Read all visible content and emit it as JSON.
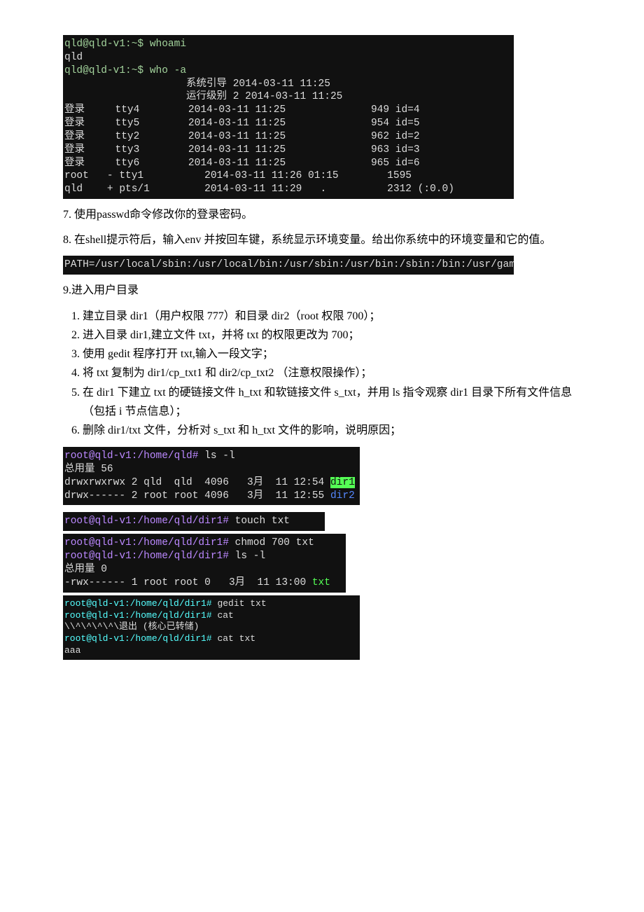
{
  "term1": {
    "l1": "qld@qld-v1:~$ whoami",
    "l2": "qld",
    "l3": "qld@qld-v1:~$ who -a",
    "l4": "                    系统引导 2014-03-11 11:25",
    "l5": "                    运行级别 2 2014-03-11 11:25",
    "l6": "登录     tty4        2014-03-11 11:25              949 id=4",
    "l7": "登录     tty5        2014-03-11 11:25              954 id=5",
    "l8": "登录     tty2        2014-03-11 11:25              962 id=2",
    "l9": "登录     tty3        2014-03-11 11:25              963 id=3",
    "l10": "登录     tty6        2014-03-11 11:25              965 id=6",
    "l11": "root   - tty1          2014-03-11 11:26 01:15        1595",
    "l12": "qld    + pts/1         2014-03-11 11:29   .          2312 (:0.0)"
  },
  "p7": "7. 使用passwd命令修改你的登录密码。",
  "p8": "8. 在shell提示符后，输入env 并按回车键，系统显示环境变量。给出你系统中的环境变量和它的值。",
  "term2": "PATH=/usr/local/sbin:/usr/local/bin:/usr/sbin:/usr/bin:/sbin:/bin:/usr/games",
  "h9": "9.进入用户目录",
  "steps": [
    "建立目录 dir1（用户权限 777）和目录 dir2（root 权限 700）；",
    "进入目录 dir1,建立文件 txt，并将 txt 的权限更改为 700；",
    "使用 gedit 程序打开 txt,输入一段文字；",
    "将 txt 复制为 dir1/cp_txt1 和 dir2/cp_txt2 （注意权限操作）；",
    "在 dir1 下建立 txt 的硬链接文件 h_txt 和软链接文件 s_txt，并用 ls 指令观察 dir1 目录下所有文件信息（包括 i 节点信息）；",
    "删除 dir1/txt 文件，分析对 s_txt 和 h_txt 文件的影响，说明原因；"
  ],
  "term3": {
    "l1p": "root@qld-v1:/home/qld#",
    "l1c": " ls -l",
    "l2": "总用量 56",
    "l3a": "drwxrwxrwx 2 qld  qld  4096   3月  11 12:54 ",
    "l3b": "dir1",
    "l4a": "drwx------ 2 root root 4096   3月  11 12:55 ",
    "l4b": "dir2"
  },
  "term4": {
    "l1p": "root@qld-v1:/home/qld/dir1#",
    "l1c": " touch txt "
  },
  "term5": {
    "l1p": "root@qld-v1:/home/qld/dir1#",
    "l1c": " chmod 700 txt",
    "l2p": "root@qld-v1:/home/qld/dir1#",
    "l2c": " ls -l",
    "l3": "总用量 0",
    "l4a": "-rwx------ 1 root root 0   3月  11 13:00 ",
    "l4b": "txt"
  },
  "term6": {
    "l1p": "root@qld-v1:/home/qld/dir1#",
    "l1c": " gedit txt",
    "l2p": "root@qld-v1:/home/qld/dir1#",
    "l2c": " cat",
    "l3": "\\\\^\\^\\^\\^\\退出 (核心已转储)",
    "l4p": "root@qld-v1:/home/qld/dir1#",
    "l4c": " cat txt",
    "l5": "aaa"
  }
}
